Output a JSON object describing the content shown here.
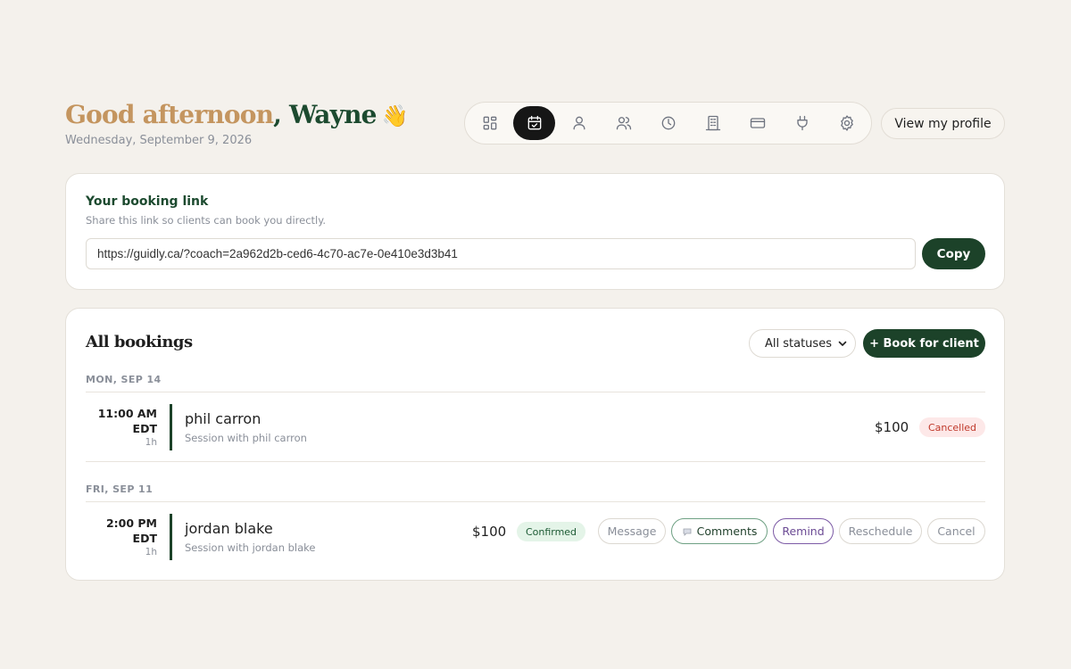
{
  "header": {
    "greeting_prefix": "Good afternoon",
    "greeting_separator": ",",
    "greeting_name": " Wayne",
    "wave_emoji": "👋",
    "date": "Wednesday, September 9, 2026",
    "profile_button": "View my profile"
  },
  "nav": {
    "items": [
      {
        "icon": "dashboard-icon",
        "active": false
      },
      {
        "icon": "calendar-icon",
        "active": true
      },
      {
        "icon": "user-icon",
        "active": false
      },
      {
        "icon": "users-icon",
        "active": false
      },
      {
        "icon": "clock-icon",
        "active": false
      },
      {
        "icon": "building-icon",
        "active": false
      },
      {
        "icon": "credit-card-icon",
        "active": false
      },
      {
        "icon": "plug-icon",
        "active": false
      },
      {
        "icon": "gear-icon",
        "active": false
      }
    ]
  },
  "booking_link": {
    "title": "Your booking link",
    "subtitle": "Share this link so clients can book you directly.",
    "url": "https://guidly.ca/?coach=2a962d2b-ced6-4c70-ac7e-0e410e3d3b41",
    "copy_label": "Copy"
  },
  "bookings": {
    "title": "All bookings",
    "status_filter": "All statuses",
    "book_button": "+ Book for client",
    "days": [
      {
        "label": "MON, SEP 14",
        "entries": [
          {
            "time_line1": "11:00 AM",
            "time_line2": "EDT",
            "duration": "1h",
            "client": "phil carron",
            "subtitle": "Session with phil carron",
            "price": "$100",
            "status": "Cancelled"
          }
        ]
      },
      {
        "label": "FRI, SEP 11",
        "entries": [
          {
            "time_line1": "2:00 PM EDT",
            "duration": "1h",
            "client": "jordan blake",
            "subtitle": "Session with jordan blake",
            "price": "$100",
            "status": "Confirmed",
            "actions": {
              "message": "Message",
              "comments": "Comments",
              "remind": "Remind",
              "reschedule": "Reschedule",
              "cancel": "Cancel"
            }
          }
        ]
      }
    ]
  },
  "colors": {
    "accent_gold": "#c4955f",
    "brand_green": "#1c4229",
    "background": "#f4f1ec",
    "cancelled_text": "#c0392b",
    "remind_purple": "#6b4a94"
  }
}
